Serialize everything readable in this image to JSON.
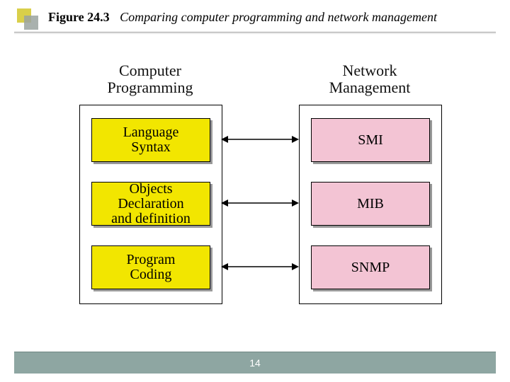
{
  "figure": {
    "number": "Figure 24.3",
    "caption": "Comparing computer programming and network management"
  },
  "diagram": {
    "left_heading_line1": "Computer",
    "left_heading_line2": "Programming",
    "right_heading_line1": "Network",
    "right_heading_line2": "Management",
    "left_nodes": {
      "r1_line1": "Language",
      "r1_line2": "Syntax",
      "r2_line1": "Objects Declaration",
      "r2_line2": "and definition",
      "r3_line1": "Program",
      "r3_line2": "Coding"
    },
    "right_nodes": {
      "r1": "SMI",
      "r2": "MIB",
      "r3": "SNMP"
    }
  },
  "footer": {
    "page_number": "14"
  }
}
